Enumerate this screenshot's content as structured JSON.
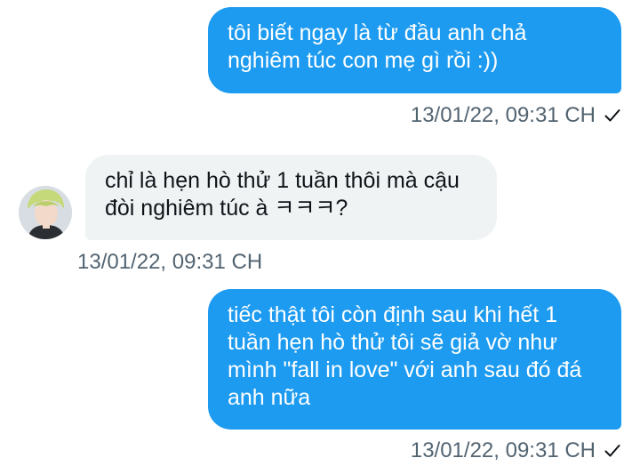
{
  "conversation": {
    "messages": [
      {
        "direction": "sent",
        "text": "tôi biết ngay là từ đầu anh chả\nnghiêm túc con mẹ gì rồi :))",
        "timestamp": "13/01/22, 09:31 CH",
        "status_icon": "check-icon"
      },
      {
        "direction": "received",
        "text": "chỉ là hẹn hò thử 1 tuần thôi mà cậu\nđòi nghiêm túc à ㅋㅋㅋ?",
        "timestamp": "13/01/22, 09:31 CH",
        "avatar_icon": "avatar"
      },
      {
        "direction": "sent",
        "text": "tiếc thật tôi còn định sau khi hết 1\ntuần hẹn hò thử tôi sẽ giả vờ như\nmình \"fall in love\" với anh sau đó đá\nanh nữa",
        "timestamp": "13/01/22, 09:31 CH",
        "status_icon": "check-icon"
      }
    ]
  },
  "colors": {
    "sent_bubble": "#1d9bf0",
    "received_bubble": "#eff3f4",
    "timestamp_text": "#536471",
    "background": "#ffffff"
  }
}
